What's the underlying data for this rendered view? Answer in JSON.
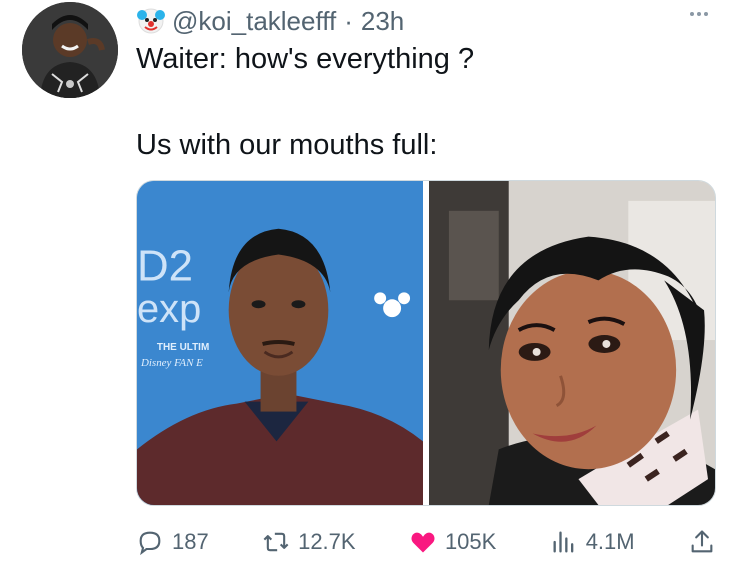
{
  "tweet": {
    "handle": "@koi_takleefff",
    "separator": "·",
    "time": "23h",
    "badge_icon": "clown-emoji",
    "more_icon": "more-dots-icon",
    "text_line1": "Waiter: how's everything ?",
    "text_line2": "Us with our mouths full:"
  },
  "media": {
    "left_image": "man-smiling-press-backdrop",
    "right_image": "woman-smiling-portrait",
    "backdrop_text": [
      "D23",
      "exp",
      "THE ULTIM",
      "Disney FAN E"
    ]
  },
  "actions": {
    "reply": {
      "icon": "reply-icon",
      "count": "187"
    },
    "retweet": {
      "icon": "retweet-icon",
      "count": "12.7K"
    },
    "like": {
      "icon": "heart-icon",
      "count": "105K",
      "color": "#f91880"
    },
    "views": {
      "icon": "views-icon",
      "count": "4.1M"
    },
    "share": {
      "icon": "share-icon"
    }
  },
  "colors": {
    "text": "#0f1419",
    "muted": "#536471",
    "like": "#f91880"
  }
}
